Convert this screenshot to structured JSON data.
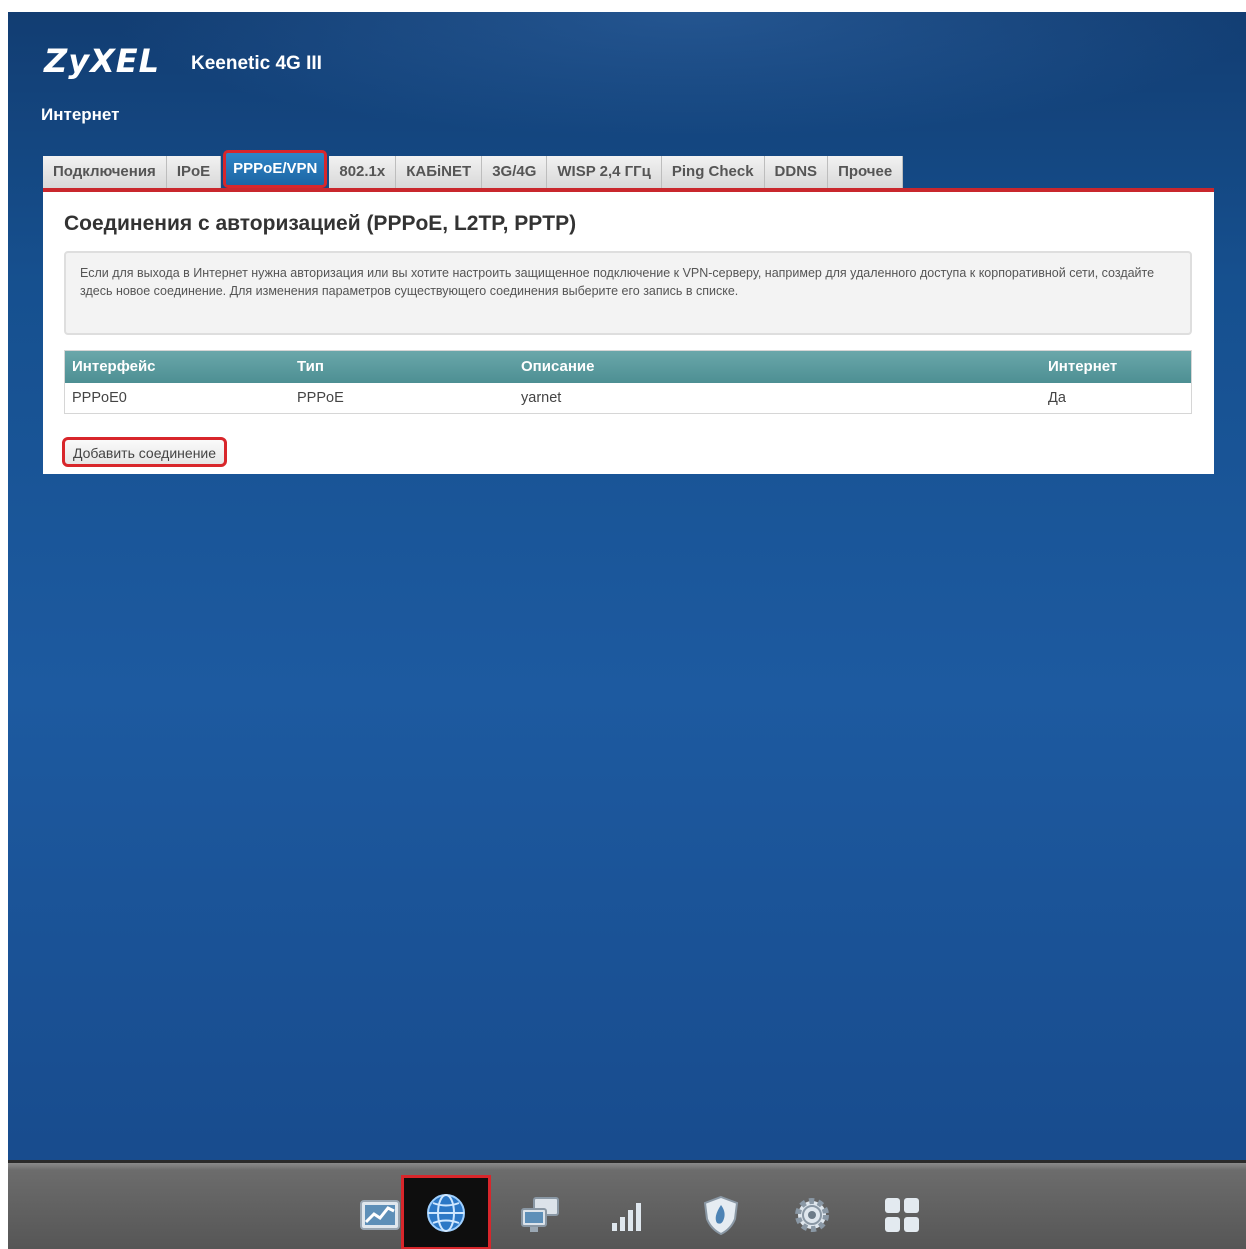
{
  "header": {
    "brand": "ZyXEL",
    "model": "Keenetic 4G III",
    "section": "Интернет"
  },
  "tabs": [
    {
      "label": "Подключения",
      "active": false
    },
    {
      "label": "IPoE",
      "active": false
    },
    {
      "label": "PPPoE/VPN",
      "active": true
    },
    {
      "label": "802.1x",
      "active": false
    },
    {
      "label": "КАБiNET",
      "active": false
    },
    {
      "label": "3G/4G",
      "active": false
    },
    {
      "label": "WISP 2,4 ГГц",
      "active": false
    },
    {
      "label": "Ping Check",
      "active": false
    },
    {
      "label": "DDNS",
      "active": false
    },
    {
      "label": "Прочее",
      "active": false
    }
  ],
  "panel": {
    "title": "Соединения с авторизацией (PPPoE, L2TP, PPTP)",
    "info": "Если для выхода в Интернет нужна авторизация или вы хотите настроить защищенное подключение к VPN-серверу, например для удаленного доступа к корпоративной сети, создайте здесь новое соединение. Для изменения параметров существующего соединения выберите его запись в списке.",
    "table": {
      "headers": [
        "Интерфейс",
        "Тип",
        "Описание",
        "Интернет"
      ],
      "rows": [
        [
          "PPPoE0",
          "PPPoE",
          "yarnet",
          "Да"
        ]
      ]
    },
    "add_button": "Добавить соединение"
  },
  "bottom_nav": [
    {
      "icon": "monitor-chart-icon",
      "active": false
    },
    {
      "icon": "internet-globe-icon",
      "active": true
    },
    {
      "icon": "home-network-icon",
      "active": false
    },
    {
      "icon": "signal-bars-icon",
      "active": false
    },
    {
      "icon": "security-shield-icon",
      "active": false
    },
    {
      "icon": "system-gear-icon",
      "active": false
    },
    {
      "icon": "apps-grid-icon",
      "active": false
    }
  ],
  "colors": {
    "accent_red": "#d8262b",
    "background_blue": "#1d5aa0",
    "table_header": "#5a9a9d"
  }
}
